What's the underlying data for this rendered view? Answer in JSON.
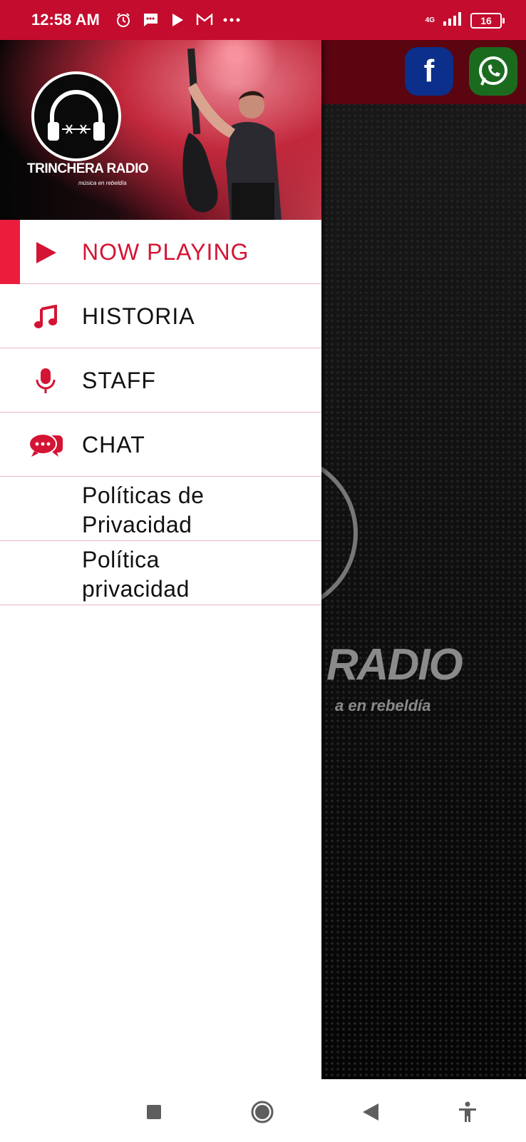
{
  "status_bar": {
    "time": "12:58 AM",
    "network": "4G",
    "battery": "16",
    "icons": [
      "alarm-icon",
      "message-icon",
      "play-icon",
      "gmail-icon",
      "more-dots-icon",
      "signal-icon",
      "battery-icon"
    ]
  },
  "background_app": {
    "logo_text": "RADIO",
    "logo_tagline": "a en rebeldía",
    "social": [
      "facebook-icon",
      "whatsapp-icon"
    ],
    "facebook_glyph": "f"
  },
  "drawer": {
    "header": {
      "logo_title": "TRINCHERA RADIO",
      "logo_tagline": "música en rebeldía"
    },
    "items": [
      {
        "label": "NOW PLAYING",
        "icon": "play-icon",
        "active": true
      },
      {
        "label": "HISTORIA",
        "icon": "music-note-icon",
        "active": false
      },
      {
        "label": "STAFF",
        "icon": "microphone-icon",
        "active": false
      },
      {
        "label": "CHAT",
        "icon": "chat-bubbles-icon",
        "active": false
      },
      {
        "label": "Políticas de Privacidad",
        "icon": "",
        "active": false
      },
      {
        "label": "Política privacidad",
        "icon": "",
        "active": false
      }
    ]
  },
  "nav_bar": {
    "buttons": [
      "recents-square-icon",
      "home-circle-icon",
      "back-triangle-icon",
      "accessibility-icon"
    ]
  },
  "colors": {
    "accent": "#d41434",
    "status_bar": "#c40c2e",
    "active_bar": "#ec1c3c"
  }
}
